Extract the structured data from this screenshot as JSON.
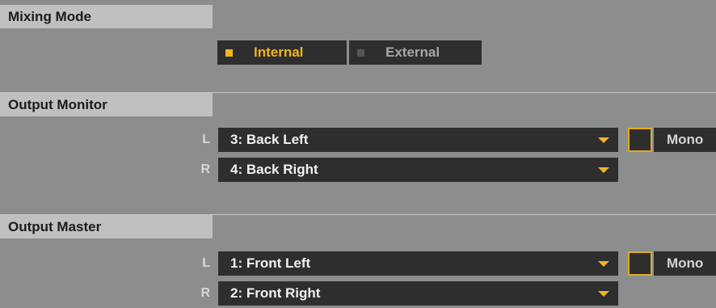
{
  "mixing_mode": {
    "title": "Mixing Mode",
    "options": [
      {
        "label": "Internal",
        "selected": true
      },
      {
        "label": "External",
        "selected": false
      }
    ]
  },
  "output_monitor": {
    "title": "Output Monitor",
    "left": {
      "channel": "L",
      "value": "3: Back Left"
    },
    "right": {
      "channel": "R",
      "value": "4: Back Right"
    },
    "mono_label": "Mono",
    "mono_checked": false
  },
  "output_master": {
    "title": "Output Master",
    "left": {
      "channel": "L",
      "value": "1: Front Left"
    },
    "right": {
      "channel": "R",
      "value": "2: Front Right"
    },
    "mono_label": "Mono",
    "mono_checked": false
  },
  "colors": {
    "background": "#8c8e8e",
    "section_header": "#bfc1c1",
    "control_dark": "#2e2e2e",
    "accent_orange": "#f0b41e",
    "inactive_indicator": "#555555"
  }
}
